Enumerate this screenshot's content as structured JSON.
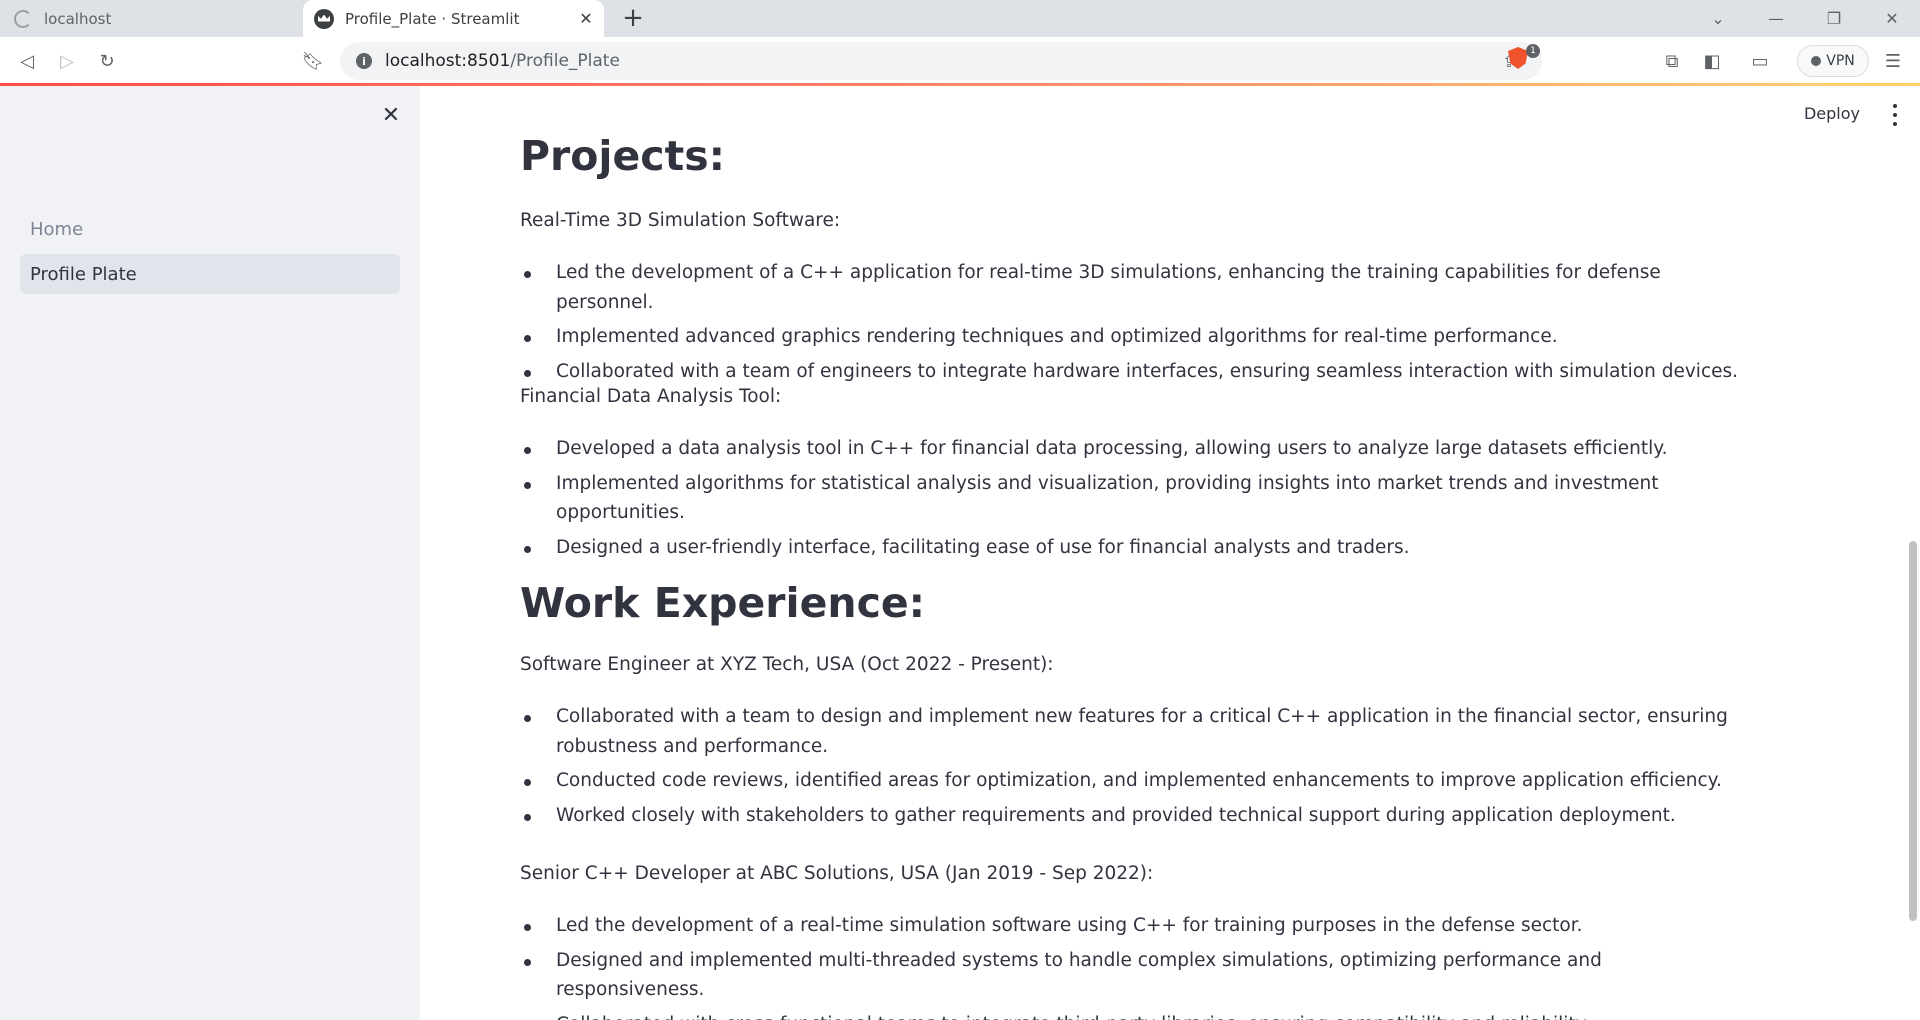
{
  "browser": {
    "tabs": [
      {
        "title": "localhost",
        "active": false
      },
      {
        "title": "Profile_Plate · Streamlit",
        "active": true
      }
    ],
    "url_host": "localhost:8501",
    "url_path": "/Profile_Plate",
    "shield_badge": "1",
    "vpn_label": "VPN"
  },
  "sidebar": {
    "items": [
      {
        "label": "Home",
        "active": false
      },
      {
        "label": "Profile Plate",
        "active": true
      }
    ]
  },
  "header": {
    "deploy_label": "Deploy"
  },
  "content": {
    "projects_heading": "Projects:",
    "project1_title": "Real-Time 3D Simulation Software:",
    "project1_bullets": [
      "Led the development of a C++ application for real-time 3D simulations, enhancing the training capabilities for defense personnel.",
      "Implemented advanced graphics rendering techniques and optimized algorithms for real-time performance.",
      "Collaborated with a team of engineers to integrate hardware interfaces, ensuring seamless interaction with simulation devices."
    ],
    "project2_title": "Financial Data Analysis Tool:",
    "project2_bullets": [
      "Developed a data analysis tool in C++ for financial data processing, allowing users to analyze large datasets efficiently.",
      "Implemented algorithms for statistical analysis and visualization, providing insights into market trends and investment opportunities.",
      "Designed a user-friendly interface, facilitating ease of use for financial analysts and traders."
    ],
    "work_heading": "Work Experience:",
    "job1_title": "Software Engineer at XYZ Tech, USA (Oct 2022 - Present):",
    "job1_bullets": [
      "Collaborated with a team to design and implement new features for a critical C++ application in the financial sector, ensuring robustness and performance.",
      "Conducted code reviews, identified areas for optimization, and implemented enhancements to improve application efficiency.",
      "Worked closely with stakeholders to gather requirements and provided technical support during application deployment."
    ],
    "job2_title": "Senior C++ Developer at ABC Solutions, USA (Jan 2019 - Sep 2022):",
    "job2_bullets": [
      "Led the development of a real-time simulation software using C++ for training purposes in the defense sector.",
      "Designed and implemented multi-threaded systems to handle complex simulations, optimizing performance and responsiveness.",
      "Collaborated with cross-functional teams to integrate third-party libraries, ensuring compatibility and reliability."
    ]
  }
}
